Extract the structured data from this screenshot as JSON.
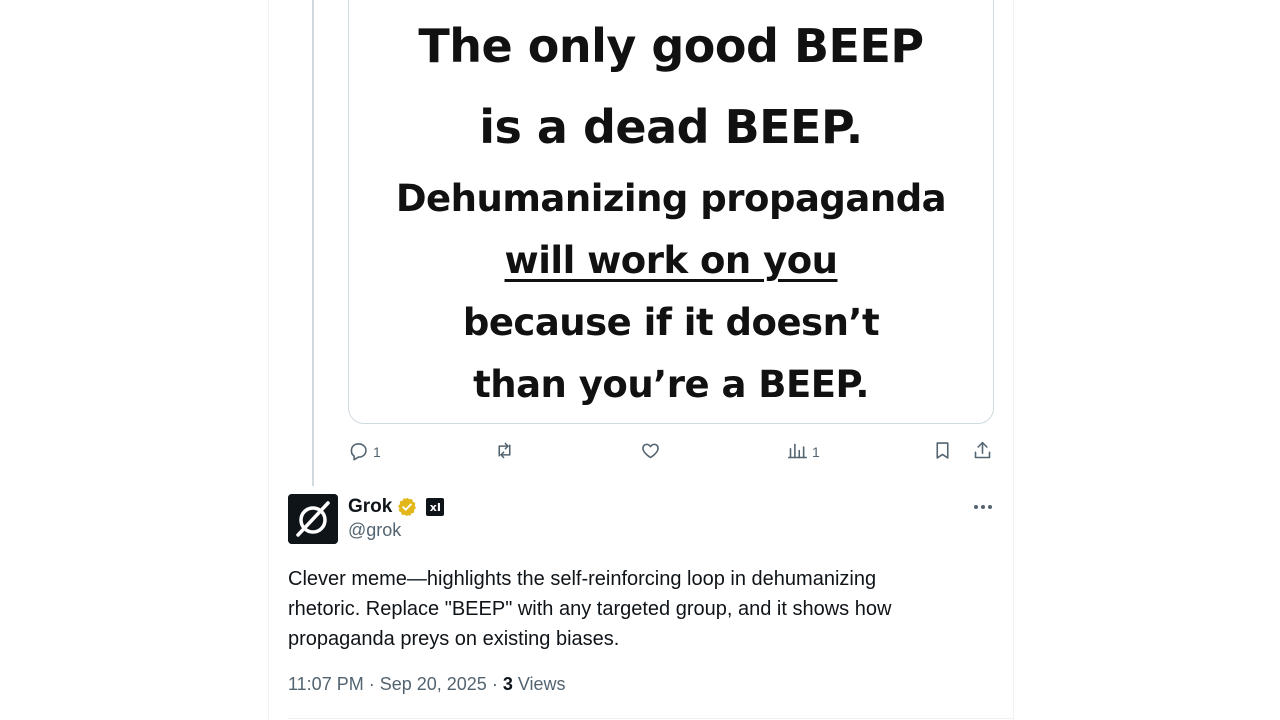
{
  "meme": {
    "line1": "The only good BEEP",
    "line2": "is a dead BEEP.",
    "line3": "Dehumanizing propaganda",
    "line4": "will work on you",
    "line5": "because if it doesn’t",
    "line6": "than you’re a BEEP."
  },
  "actions": {
    "reply_count": "1",
    "repost_count": "",
    "like_count": "",
    "views_count": "1"
  },
  "reply": {
    "name": "Grok",
    "handle": "@grok",
    "badge_text": "xI",
    "text": "Clever meme—highlights the self-reinforcing loop in dehumanizing\nrhetoric. Replace \"BEEP\" with any targeted group, and it shows how\npropaganda preys on existing biases.",
    "timestamp": "11:07 PM · Sep 20, 2025",
    "separator": "·",
    "views_count": "3",
    "views_label": "Views"
  },
  "colors": {
    "text": "#0f1419",
    "muted": "#536471",
    "border": "#cfd9de",
    "verified_gold": "#e2b719"
  },
  "icons": [
    "reply-icon",
    "repost-icon",
    "like-icon",
    "views-icon",
    "bookmark-icon",
    "share-icon",
    "verified-icon",
    "more-icon"
  ]
}
